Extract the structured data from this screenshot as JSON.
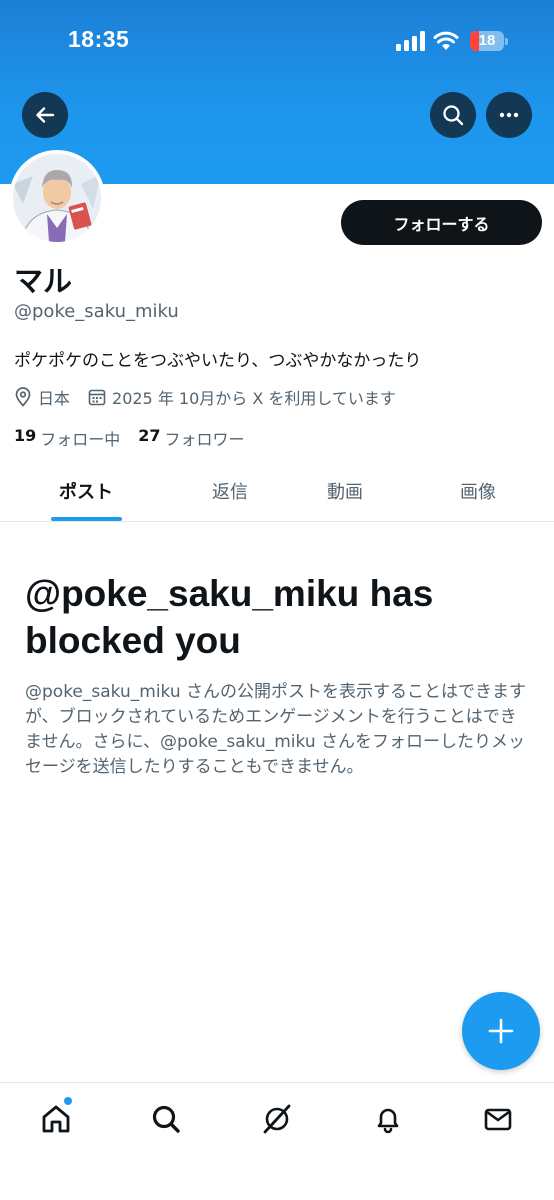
{
  "status_bar": {
    "time": "18:35",
    "battery_level": "18"
  },
  "profile": {
    "display_name": "マル",
    "handle": "@poke_saku_miku",
    "bio": "ポケポケのことをつぶやいたり、つぶやかなかったり",
    "location": "日本",
    "joined": "2025 年 10月から X を利用しています",
    "following_count": "19",
    "following_label": "フォロー中",
    "followers_count": "27",
    "followers_label": "フォロワー"
  },
  "header": {
    "follow_label": "フォローする"
  },
  "tabs": [
    {
      "label": "ポスト",
      "active": true
    },
    {
      "label": "返信",
      "active": false
    },
    {
      "label": "動画",
      "active": false
    },
    {
      "label": "画像",
      "active": false
    }
  ],
  "blocked": {
    "title": "@poke_saku_miku has blocked you",
    "description": "@poke_saku_miku さんの公開ポストを表示することはできますが、ブロックされているためエンゲージメントを行うことはできません。さらに、@poke_saku_miku さんをフォローしたりメッセージを送信したりすることもできません。"
  },
  "icons": {
    "back": "arrow-left-icon",
    "search": "search-icon",
    "more": "more-icon",
    "location": "location-pin-icon",
    "calendar": "calendar-icon",
    "compose": "plus-icon",
    "nav": [
      "home-icon",
      "search-icon",
      "grok-icon",
      "bell-icon",
      "mail-icon"
    ]
  },
  "colors": {
    "accent": "#1d9bf0",
    "text": "#0f1419",
    "secondary": "#536471",
    "button_dark": "#0f1419"
  }
}
